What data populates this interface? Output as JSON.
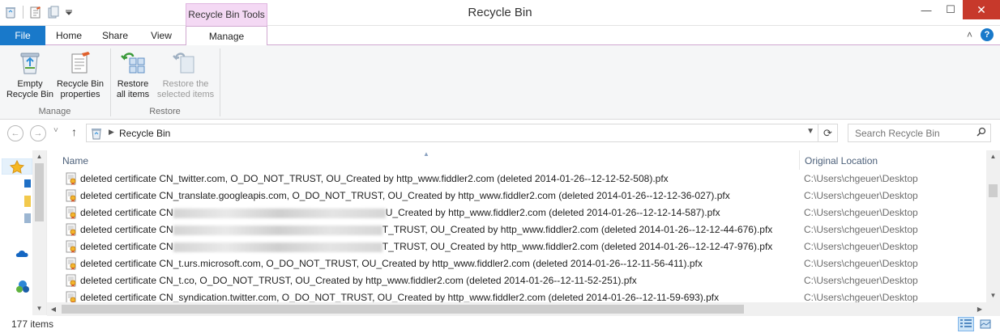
{
  "window": {
    "title": "Recycle Bin",
    "context_tab_header": "Recycle Bin Tools",
    "minimize": "—",
    "maximize": "☐",
    "close": "✕"
  },
  "ribbon": {
    "tabs": {
      "file": "File",
      "home": "Home",
      "share": "Share",
      "view": "View",
      "manage": "Manage"
    },
    "collapse_glyph": "˄",
    "help_glyph": "?",
    "groups": {
      "manage": {
        "label": "Manage",
        "empty_bin_line1": "Empty",
        "empty_bin_line2": "Recycle Bin",
        "properties_line1": "Recycle Bin",
        "properties_line2": "properties"
      },
      "restore": {
        "label": "Restore",
        "restore_all_line1": "Restore",
        "restore_all_line2": "all items",
        "restore_selected_line1": "Restore the",
        "restore_selected_line2": "selected items"
      }
    }
  },
  "nav": {
    "back": "←",
    "forward": "→",
    "recent": "˅",
    "up": "↑",
    "breadcrumb": "Recycle Bin",
    "search_placeholder": "Search Recycle Bin"
  },
  "columns": {
    "name": "Name",
    "original_location": "Original Location"
  },
  "files": [
    {
      "name": "deleted certificate CN_twitter.com, O_DO_NOT_TRUST, OU_Created by http_www.fiddler2.com (deleted 2014-01-26--12-12-52-508).pfx",
      "location": "C:\\Users\\chgeuer\\Desktop",
      "redacted": false
    },
    {
      "name": "deleted certificate CN_translate.googleapis.com, O_DO_NOT_TRUST, OU_Created by http_www.fiddler2.com (deleted 2014-01-26--12-12-36-027).pfx",
      "location": "C:\\Users\\chgeuer\\Desktop",
      "redacted": false
    },
    {
      "name_prefix": "deleted certificate CN",
      "name_suffix": "U_Created by http_www.fiddler2.com (deleted 2014-01-26--12-12-14-587).pfx",
      "location": "C:\\Users\\chgeuer\\Desktop",
      "redacted": true
    },
    {
      "name_prefix": "deleted certificate CN",
      "name_suffix": "T_TRUST, OU_Created by http_www.fiddler2.com (deleted 2014-01-26--12-12-44-676).pfx",
      "location": "C:\\Users\\chgeuer\\Desktop",
      "redacted": true
    },
    {
      "name_prefix": "deleted certificate CN",
      "name_suffix": "T_TRUST, OU_Created by http_www.fiddler2.com (deleted 2014-01-26--12-12-47-976).pfx",
      "location": "C:\\Users\\chgeuer\\Desktop",
      "redacted": true
    },
    {
      "name": "deleted certificate CN_t.urs.microsoft.com, O_DO_NOT_TRUST, OU_Created by http_www.fiddler2.com (deleted 2014-01-26--12-11-56-411).pfx",
      "location": "C:\\Users\\chgeuer\\Desktop",
      "redacted": false
    },
    {
      "name": "deleted certificate CN_t.co, O_DO_NOT_TRUST, OU_Created by http_www.fiddler2.com (deleted 2014-01-26--12-11-52-251).pfx",
      "location": "C:\\Users\\chgeuer\\Desktop",
      "redacted": false
    },
    {
      "name": "deleted certificate CN_syndication.twitter.com, O_DO_NOT_TRUST, OU_Created by http_www.fiddler2.com (deleted 2014-01-26--12-11-59-693).pfx",
      "location": "C:\\Users\\chgeuer\\Desktop",
      "redacted": false
    }
  ],
  "status": {
    "item_count": "177 items"
  },
  "colors": {
    "file_tab": "#1979ca",
    "context_tab": "#f4d9f4",
    "close_button": "#c7392b",
    "ribbon_bg": "#f5f6f7"
  }
}
